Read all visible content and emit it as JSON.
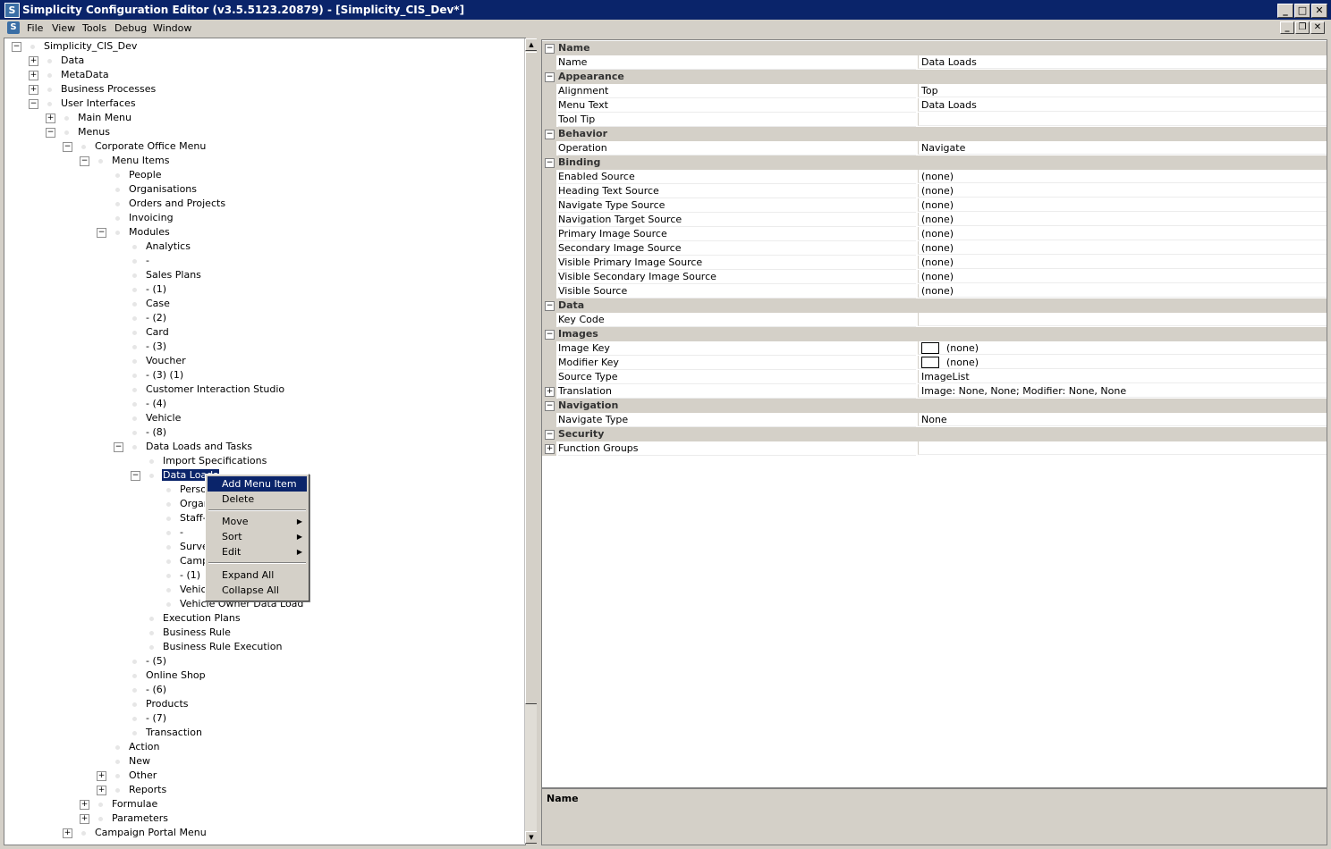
{
  "window": {
    "title": "Simplicity Configuration Editor (v3.5.5123.20879) - [Simplicity_CIS_Dev*]"
  },
  "menubar": {
    "items": [
      "File",
      "View",
      "Tools",
      "Debug",
      "Window"
    ]
  },
  "tree": {
    "nodes": [
      {
        "label": "Simplicity_CIS_Dev",
        "level": 0,
        "toggle": "minus"
      },
      {
        "label": "Data",
        "level": 1,
        "toggle": "plus"
      },
      {
        "label": "MetaData",
        "level": 1,
        "toggle": "plus"
      },
      {
        "label": "Business Processes",
        "level": 1,
        "toggle": "plus"
      },
      {
        "label": "User Interfaces",
        "level": 1,
        "toggle": "minus"
      },
      {
        "label": "Main Menu",
        "level": 2,
        "toggle": "plus"
      },
      {
        "label": "Menus",
        "level": 2,
        "toggle": "minus"
      },
      {
        "label": "Corporate Office Menu",
        "level": 3,
        "toggle": "minus"
      },
      {
        "label": "Menu Items",
        "level": 4,
        "toggle": "minus"
      },
      {
        "label": "People",
        "level": 5,
        "toggle": "none"
      },
      {
        "label": "Organisations",
        "level": 5,
        "toggle": "none"
      },
      {
        "label": "Orders and Projects",
        "level": 5,
        "toggle": "none"
      },
      {
        "label": "Invoicing",
        "level": 5,
        "toggle": "none"
      },
      {
        "label": "Modules",
        "level": 5,
        "toggle": "minus"
      },
      {
        "label": "Analytics",
        "level": 6,
        "toggle": "none"
      },
      {
        "label": "-",
        "level": 6,
        "toggle": "none"
      },
      {
        "label": "Sales Plans",
        "level": 6,
        "toggle": "none"
      },
      {
        "label": "- (1)",
        "level": 6,
        "toggle": "none"
      },
      {
        "label": "Case",
        "level": 6,
        "toggle": "none"
      },
      {
        "label": "- (2)",
        "level": 6,
        "toggle": "none"
      },
      {
        "label": "Card",
        "level": 6,
        "toggle": "none"
      },
      {
        "label": "- (3)",
        "level": 6,
        "toggle": "none"
      },
      {
        "label": "Voucher",
        "level": 6,
        "toggle": "none"
      },
      {
        "label": "- (3) (1)",
        "level": 6,
        "toggle": "none"
      },
      {
        "label": "Customer Interaction Studio",
        "level": 6,
        "toggle": "none"
      },
      {
        "label": "- (4)",
        "level": 6,
        "toggle": "none"
      },
      {
        "label": "Vehicle",
        "level": 6,
        "toggle": "none"
      },
      {
        "label": "- (8)",
        "level": 6,
        "toggle": "none"
      },
      {
        "label": "Data Loads and Tasks",
        "level": 6,
        "toggle": "minus"
      },
      {
        "label": "Import Specifications",
        "level": 7,
        "toggle": "none"
      },
      {
        "label": "Data Loads",
        "level": 7,
        "toggle": "minus",
        "selected": true
      },
      {
        "label": "Person Data Load",
        "level": 8,
        "toggle": "none"
      },
      {
        "label": "Organisation Data Load",
        "level": 8,
        "toggle": "none"
      },
      {
        "label": "Staff-Member Data Load",
        "level": 8,
        "toggle": "none"
      },
      {
        "label": "-",
        "level": 8,
        "toggle": "none"
      },
      {
        "label": "Survey Data Load",
        "level": 8,
        "toggle": "none"
      },
      {
        "label": "Campaign List Data Load",
        "level": 8,
        "toggle": "none"
      },
      {
        "label": "- (1)",
        "level": 8,
        "toggle": "none"
      },
      {
        "label": "Vehicle Data Load",
        "level": 8,
        "toggle": "none"
      },
      {
        "label": "Vehicle Owner Data Load",
        "level": 8,
        "toggle": "none"
      },
      {
        "label": "Execution Plans",
        "level": 7,
        "toggle": "none"
      },
      {
        "label": "Business Rule",
        "level": 7,
        "toggle": "none"
      },
      {
        "label": "Business Rule Execution",
        "level": 7,
        "toggle": "none"
      },
      {
        "label": "- (5)",
        "level": 6,
        "toggle": "none"
      },
      {
        "label": "Online Shop",
        "level": 6,
        "toggle": "none"
      },
      {
        "label": "- (6)",
        "level": 6,
        "toggle": "none"
      },
      {
        "label": "Products",
        "level": 6,
        "toggle": "none"
      },
      {
        "label": "- (7)",
        "level": 6,
        "toggle": "none"
      },
      {
        "label": "Transaction",
        "level": 6,
        "toggle": "none"
      },
      {
        "label": "Action",
        "level": 5,
        "toggle": "none"
      },
      {
        "label": "New",
        "level": 5,
        "toggle": "none"
      },
      {
        "label": "Other",
        "level": 5,
        "toggle": "plus"
      },
      {
        "label": "Reports",
        "level": 5,
        "toggle": "plus"
      },
      {
        "label": "Formulae",
        "level": 4,
        "toggle": "plus"
      },
      {
        "label": "Parameters",
        "level": 4,
        "toggle": "plus"
      },
      {
        "label": "Campaign Portal Menu",
        "level": 3,
        "toggle": "plus"
      }
    ]
  },
  "context_menu": {
    "items": [
      "Add Menu Item",
      "Delete",
      "Move",
      "Sort",
      "Edit",
      "Expand All",
      "Collapse All"
    ],
    "highlighted": "Add Menu Item"
  },
  "properties": {
    "rows": [
      {
        "type": "cat",
        "name": "Name"
      },
      {
        "type": "prop",
        "name": "Name",
        "value": "Data Loads"
      },
      {
        "type": "cat",
        "name": "Appearance"
      },
      {
        "type": "prop",
        "name": "Alignment",
        "value": "Top"
      },
      {
        "type": "prop",
        "name": "Menu Text",
        "value": "Data Loads"
      },
      {
        "type": "prop",
        "name": "Tool Tip",
        "value": ""
      },
      {
        "type": "cat",
        "name": "Behavior"
      },
      {
        "type": "prop",
        "name": "Operation",
        "value": "Navigate"
      },
      {
        "type": "cat",
        "name": "Binding"
      },
      {
        "type": "prop",
        "name": "Enabled Source",
        "value": "(none)"
      },
      {
        "type": "prop",
        "name": "Heading Text Source",
        "value": "(none)"
      },
      {
        "type": "prop",
        "name": "Navigate Type Source",
        "value": "(none)"
      },
      {
        "type": "prop",
        "name": "Navigation Target Source",
        "value": "(none)"
      },
      {
        "type": "prop",
        "name": "Primary Image Source",
        "value": "(none)"
      },
      {
        "type": "prop",
        "name": "Secondary Image Source",
        "value": "(none)"
      },
      {
        "type": "prop",
        "name": "Visible Primary Image Source",
        "value": "(none)"
      },
      {
        "type": "prop",
        "name": "Visible Secondary Image Source",
        "value": "(none)"
      },
      {
        "type": "prop",
        "name": "Visible Source",
        "value": "(none)"
      },
      {
        "type": "cat",
        "name": "Data"
      },
      {
        "type": "prop",
        "name": "Key Code",
        "value": ""
      },
      {
        "type": "cat",
        "name": "Images"
      },
      {
        "type": "prop",
        "name": "Image Key",
        "value": "(none)",
        "swatch": true
      },
      {
        "type": "prop",
        "name": "Modifier Key",
        "value": "(none)",
        "swatch": true
      },
      {
        "type": "prop",
        "name": "Source Type",
        "value": "ImageList"
      },
      {
        "type": "prop",
        "name": "Translation",
        "value": "Image: None, None; Modifier: None, None",
        "expand": "plus"
      },
      {
        "type": "cat",
        "name": "Navigation"
      },
      {
        "type": "prop",
        "name": "Navigate Type",
        "value": "None"
      },
      {
        "type": "cat",
        "name": "Security"
      },
      {
        "type": "prop",
        "name": "Function Groups",
        "value": "",
        "expand": "plus"
      }
    ]
  },
  "description": {
    "title": "Name"
  },
  "icons": {
    "app": "simplicity-logo-icon",
    "minimize": "minimize-icon",
    "restore": "restore-icon",
    "close": "close-icon",
    "scroll_up": "scroll-up-icon",
    "scroll_down": "scroll-down-icon"
  },
  "colors": {
    "titlebar": "#0a246a",
    "chrome": "#d4d0c8",
    "selection": "#0a246a"
  }
}
